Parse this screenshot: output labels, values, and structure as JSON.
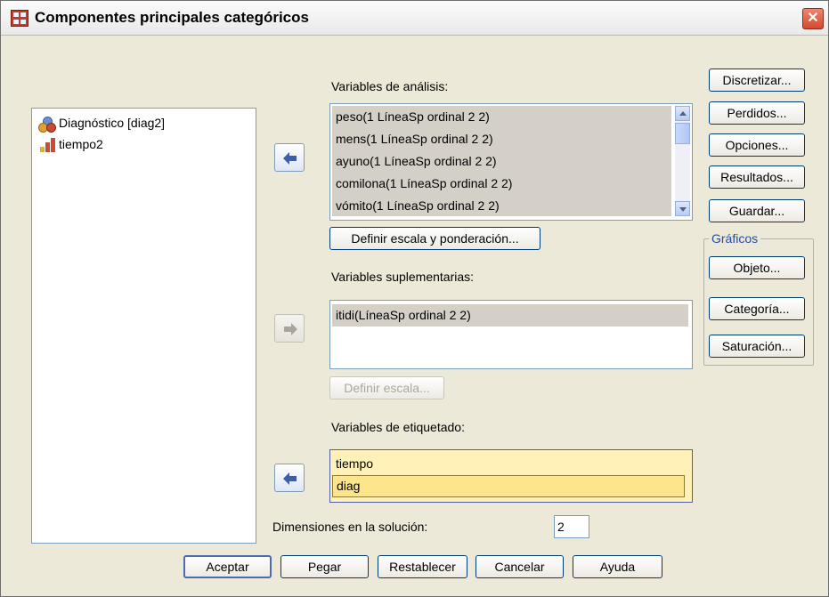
{
  "window": {
    "title": "Componentes principales categóricos",
    "close_glyph": "✕"
  },
  "source_list": {
    "items": [
      {
        "label": "Diagnóstico [diag2]",
        "icon": "nominal-variable-icon"
      },
      {
        "label": "tiempo2",
        "icon": "scale-variable-icon"
      }
    ]
  },
  "analysis": {
    "label": "Variables de análisis:",
    "items": [
      "peso(1 LíneaSp ordinal 2 2)",
      "mens(1 LíneaSp ordinal 2 2)",
      "ayuno(1 LíneaSp ordinal 2 2)",
      "comilona(1 LíneaSp ordinal 2 2)",
      "vómito(1 LíneaSp ordinal 2 2)"
    ],
    "define_button": "Definir escala y ponderación..."
  },
  "supplementary": {
    "label": "Variables suplementarias:",
    "items": [
      "itidi(LíneaSp ordinal 2 2)"
    ],
    "define_button": "Definir escala..."
  },
  "labeling": {
    "label": "Variables de etiquetado:",
    "items": [
      "tiempo",
      "diag"
    ]
  },
  "dimensions": {
    "label": "Dimensiones en la solución:",
    "value": "2"
  },
  "side_buttons": [
    "Discretizar...",
    "Perdidos...",
    "Opciones...",
    "Resultados...",
    "Guardar..."
  ],
  "plots": {
    "title": "Gráficos",
    "buttons": [
      "Objeto...",
      "Categoría...",
      "Saturación..."
    ]
  },
  "bottom_buttons": [
    "Aceptar",
    "Pegar",
    "Restablecer",
    "Cancelar",
    "Ayuda"
  ],
  "colors": {
    "selection_gray": "#d4d0c8",
    "label_list_bg": "#fff1b8",
    "dialog_bg": "#ece9d8",
    "arrow_blue": "#3d5ea8"
  }
}
